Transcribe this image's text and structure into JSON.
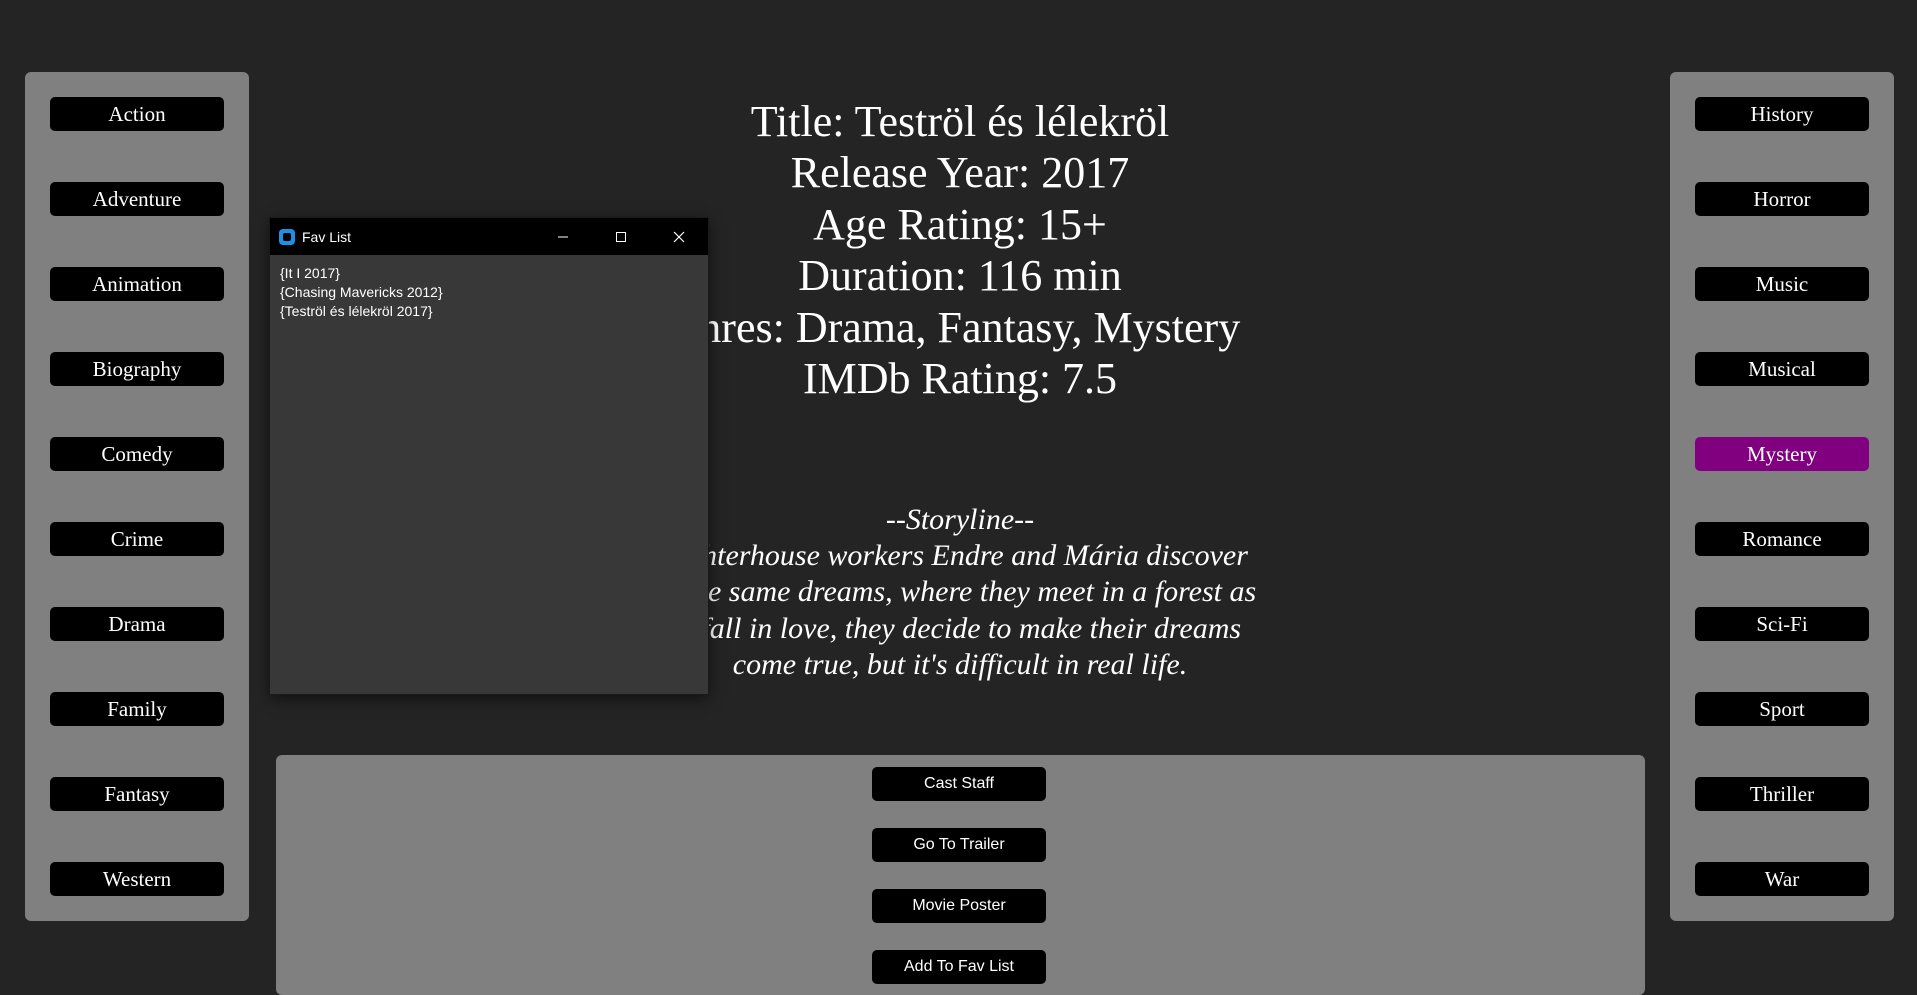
{
  "left_genres": [
    "Action",
    "Adventure",
    "Animation",
    "Biography",
    "Comedy",
    "Crime",
    "Drama",
    "Family",
    "Fantasy",
    "Western"
  ],
  "right_genres": [
    "History",
    "Horror",
    "Music",
    "Musical",
    "Mystery",
    "Romance",
    "Sci-Fi",
    "Sport",
    "Thriller",
    "War"
  ],
  "active_genre": "Mystery",
  "colors": {
    "background": "#242424",
    "panel": "#808080",
    "button": "#000000",
    "active": "#800080",
    "fav_window": "#383838"
  },
  "movie": {
    "title_line": "Title: Teströl és lélekröl",
    "year_line": "Release Year: 2017",
    "age_line": "Age Rating: 15+",
    "duration_line": "Duration: 116 min",
    "genres_line": "enres: Drama, Fantasy, Mystery",
    "imdb_line": "IMDb Rating: 7.5"
  },
  "storyline": {
    "heading": "--Storyline--",
    "lines": [
      "ughterhouse workers Endre and Mária discover",
      "e the same dreams, where they meet in a forest as",
      "d fall in love, they decide to make their dreams",
      "come true, but it's difficult in real life."
    ]
  },
  "actions": [
    "Cast Staff",
    "Go To Trailer",
    "Movie Poster",
    "Add To Fav List"
  ],
  "fav_window": {
    "title": "Fav List",
    "items": [
      "{It I 2017}",
      "{Chasing Mavericks 2012}",
      "{Teströl és lélekröl 2017}"
    ],
    "controls": [
      "minimize-icon",
      "maximize-icon",
      "close-icon"
    ]
  }
}
